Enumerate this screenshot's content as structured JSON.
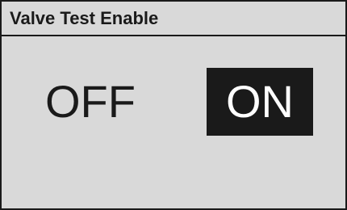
{
  "window": {
    "title": "Valve Test Enable"
  },
  "toggle": {
    "off_label": "OFF",
    "on_label": "ON",
    "selected": "ON"
  },
  "colors": {
    "background": "#d9d9d9",
    "foreground": "#1a1a1a",
    "selected_text": "#ffffff"
  }
}
